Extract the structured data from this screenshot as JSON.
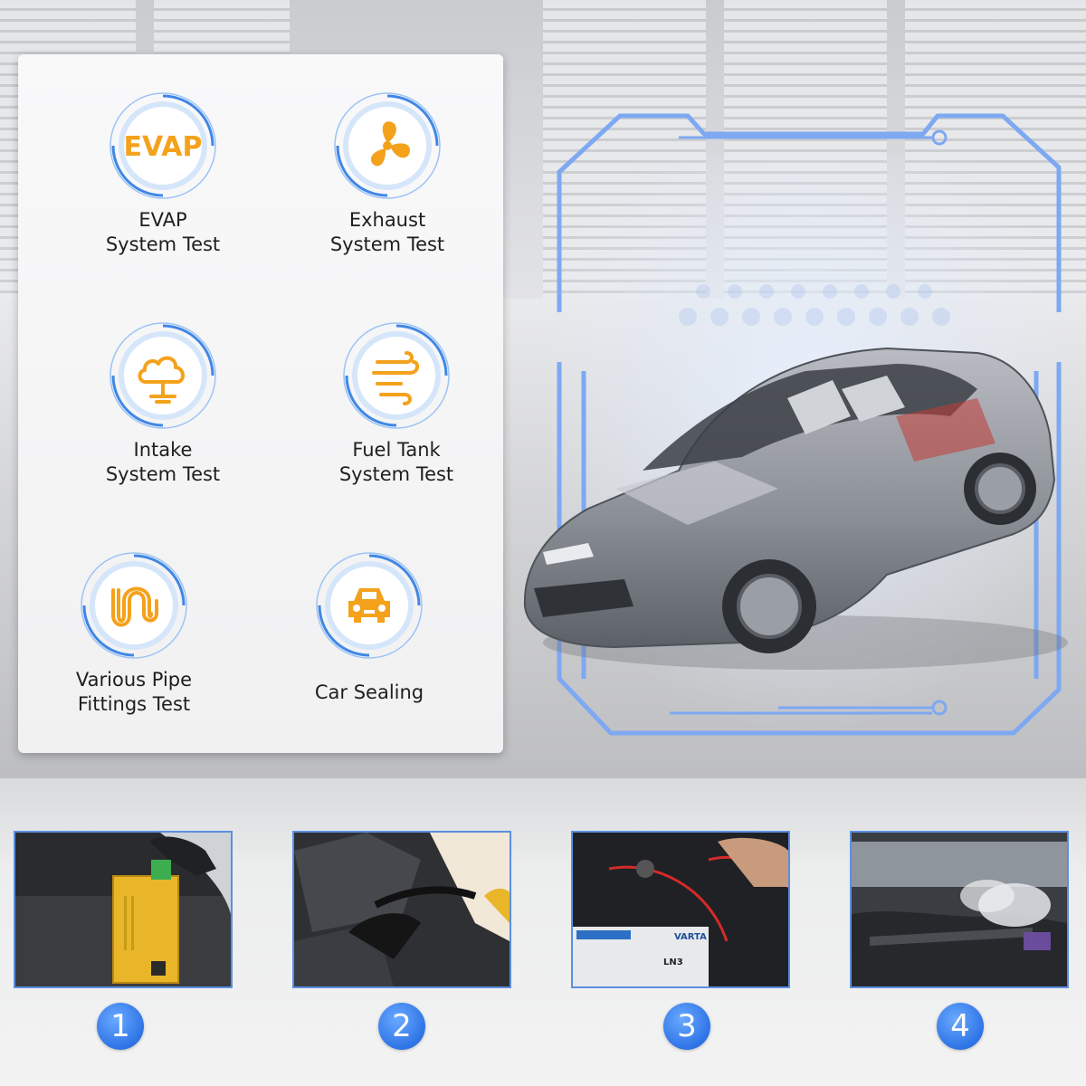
{
  "features": [
    {
      "label_lines": [
        "EVAP",
        "System Test"
      ],
      "icon": "evap-icon",
      "icon_text": "EVAP"
    },
    {
      "label_lines": [
        "Exhaust",
        "System Test"
      ],
      "icon": "fan-icon"
    },
    {
      "label_lines": [
        "Intake",
        "System Test"
      ],
      "icon": "cloud-icon"
    },
    {
      "label_lines": [
        "Fuel Tank",
        "System Test"
      ],
      "icon": "wind-icon"
    },
    {
      "label_lines": [
        "Various Pipe",
        "Fittings Test"
      ],
      "icon": "pipe-icon"
    },
    {
      "label_lines": [
        "Car Sealing"
      ],
      "icon": "car-icon"
    }
  ],
  "steps": [
    {
      "number": "1",
      "image": "smoke-machine-photo"
    },
    {
      "number": "2",
      "image": "hose-insertion-photo"
    },
    {
      "number": "3",
      "image": "battery-clamp-photo"
    },
    {
      "number": "4",
      "image": "smoke-leak-photo"
    }
  ],
  "battery_brand": "VARTA",
  "battery_model": "LN3",
  "colors": {
    "accent_orange": "#F4A21C",
    "ring_blue": "#5B9BEA",
    "frame_blue": "#7EA8F2",
    "step_blue": "#2E74E6"
  }
}
